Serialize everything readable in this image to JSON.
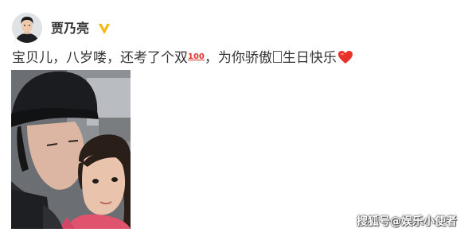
{
  "post": {
    "author": "贾乃亮",
    "verified_icon": "gold-verified-badge-icon",
    "text_before_emoji": "宝贝儿，八岁喽，还考了个双",
    "emoji_100": "100",
    "text_after_emoji": "，为你骄傲",
    "text_after_glyph": "生日快乐",
    "heart_icon": "red-heart-icon",
    "photo": "selfie-man-in-black-bucket-hat-with-girl-in-pink"
  },
  "watermark": "搜狐号@娱乐小使者",
  "colors": {
    "heart": "#e8312a",
    "verified_badge": "#f7b500",
    "text": "#333333"
  }
}
